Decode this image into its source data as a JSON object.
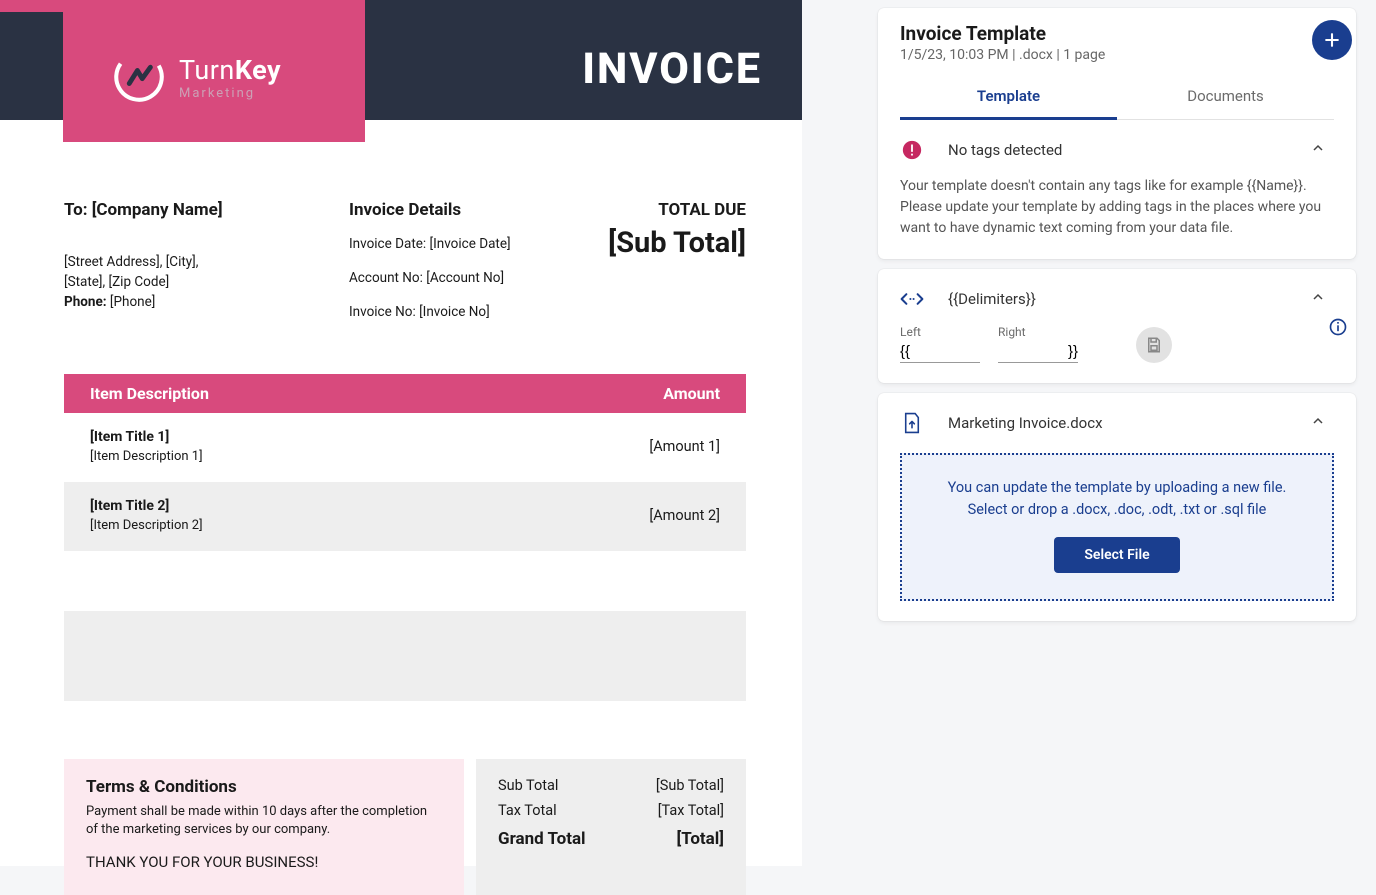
{
  "doc": {
    "brand_a": "Turn",
    "brand_b": "Key",
    "brand_sub": "Marketing",
    "invoice_title": "INVOICE",
    "to_header": "To: [Company Name]",
    "to_addr1": "[Street Address], [City],",
    "to_addr2": "[State], [Zip Code]",
    "to_phone_label": "Phone:",
    "to_phone": "[Phone]",
    "details_header": "Invoice Details",
    "details_date": "Invoice Date: [Invoice Date]",
    "details_account": "Account No: [Account No]",
    "details_invoice_no": "Invoice No: [Invoice No]",
    "total_due_label": "TOTAL DUE",
    "total_due_value": "[Sub Total]",
    "col_desc": "Item Description",
    "col_amount": "Amount",
    "items": [
      {
        "title": "[Item Title 1]",
        "desc": "[Item Description 1]",
        "amount": "[Amount 1]"
      },
      {
        "title": "[Item Title 2]",
        "desc": "[Item Description 2]",
        "amount": "[Amount 2]"
      }
    ],
    "terms_h": "Terms & Conditions",
    "terms_body": "Payment shall be made within 10 days after the completion of the marketing services by our company.",
    "terms_thanks": "THANK YOU FOR YOUR BUSINESS!",
    "subtotal_label": "Sub Total",
    "subtotal_value": "[Sub Total]",
    "taxtotal_label": "Tax Total",
    "taxtotal_value": "[Tax Total]",
    "grandtotal_label": "Grand Total",
    "grandtotal_value": "[Total]"
  },
  "panel": {
    "title": "Invoice Template",
    "meta": "1/5/23, 10:03 PM | .docx | 1 page",
    "tab_template": "Template",
    "tab_documents": "Documents",
    "warn_title": "No tags detected",
    "warn_body": "Your template doesn't contain any tags like for example {{Name}}. Please update your template by adding tags in the places where you want to have dynamic text coming from your data file.",
    "delim_title": "{{Delimiters}}",
    "delim_left_label": "Left",
    "delim_right_label": "Right",
    "delim_left": "{{",
    "delim_right": "}}",
    "file_name": "Marketing Invoice.docx",
    "upload_line1": "You can update the template by uploading a new file.",
    "upload_line2": "Select or drop a .docx, .doc, .odt, .txt or .sql file",
    "select_file": "Select File"
  }
}
